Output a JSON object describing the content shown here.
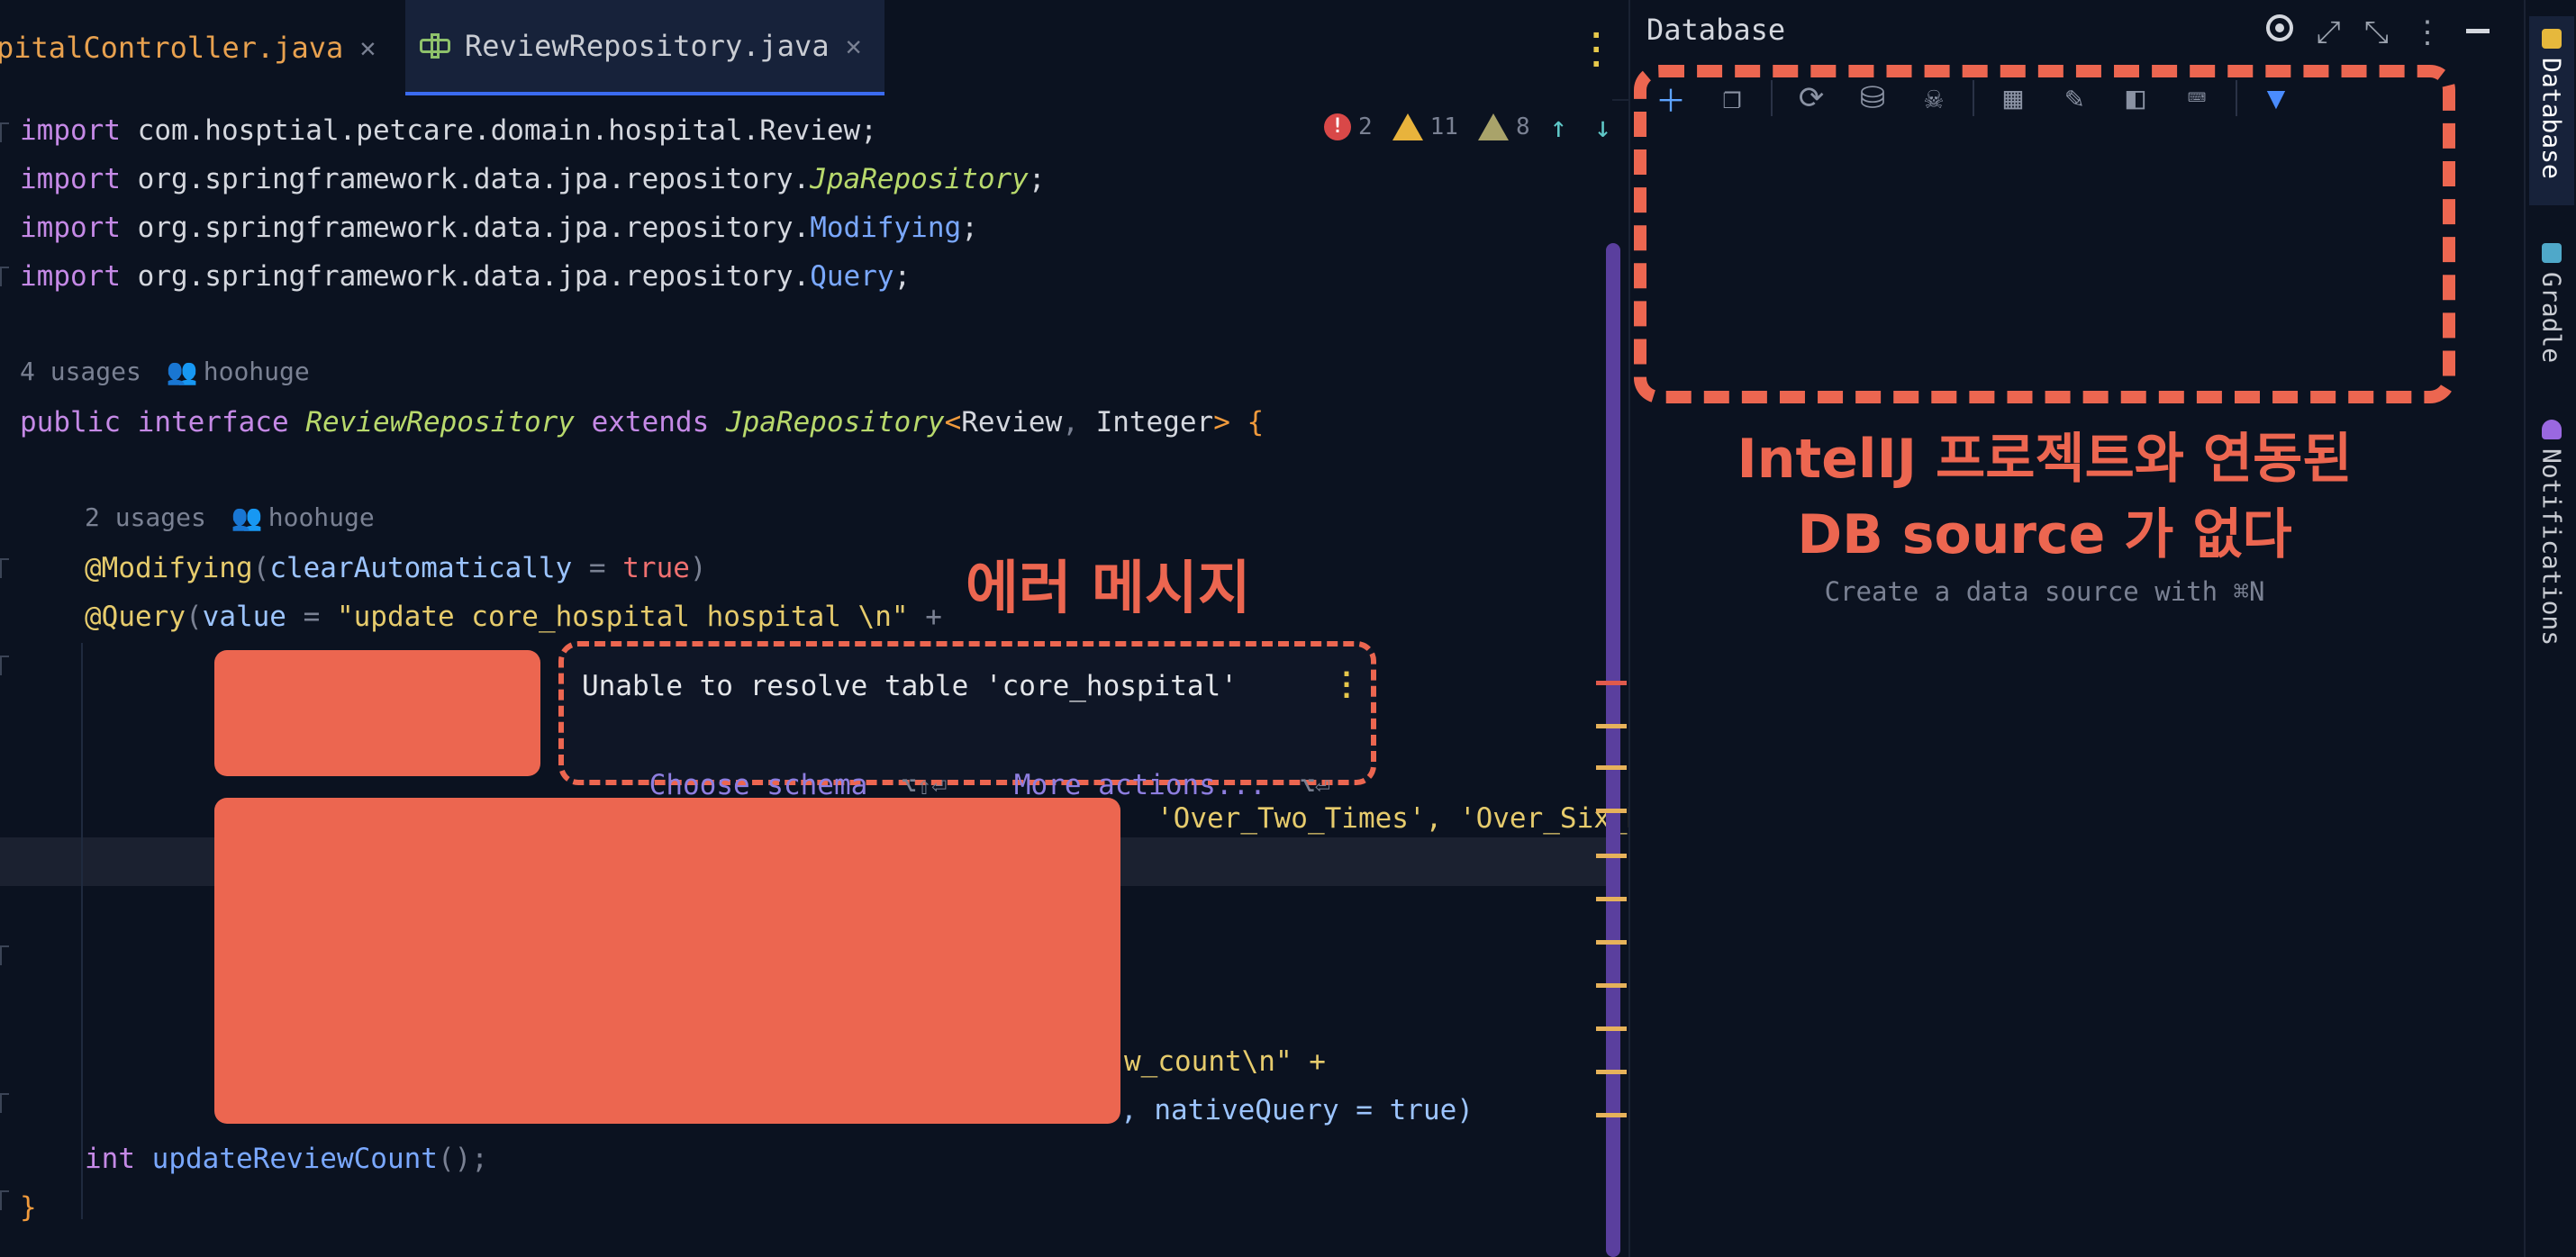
{
  "tabs": [
    {
      "label": "pitalController.java",
      "active": false
    },
    {
      "label": "ReviewRepository.java",
      "active": true
    }
  ],
  "inspections": {
    "errors": "2",
    "warnings": "11",
    "weak_warnings": "8"
  },
  "code": {
    "imports": [
      {
        "kw": "import",
        "pkg": "com.hosptial.petcare.domain.hospital.",
        "cls": "Review",
        "semi": ";"
      },
      {
        "kw": "import",
        "pkg": "org.springframework.data.jpa.repository.",
        "cls": "JpaRepository",
        "semi": ";"
      },
      {
        "kw": "import",
        "pkg": "org.springframework.data.jpa.repository.",
        "cls": "Modifying",
        "semi": ";"
      },
      {
        "kw": "import",
        "pkg": "org.springframework.data.jpa.repository.",
        "cls": "Query",
        "semi": ";"
      }
    ],
    "hint1": {
      "usages": "4 usages",
      "author": "hoohuge"
    },
    "interface_line": {
      "kw1": "public",
      "kw2": "interface",
      "name": "ReviewRepository",
      "kw3": "extends",
      "parent": "JpaRepository",
      "generic_open": "<",
      "t1": "Review",
      "comma": ", ",
      "t2": "Integer",
      "generic_close": ">",
      "brace": " {"
    },
    "hint2": {
      "usages": "2 usages",
      "author": "hoohuge"
    },
    "modifying": {
      "ann": "@Modifying",
      "open": "(",
      "param": "clearAutomatically",
      "eq": " = ",
      "value": "true",
      "close": ")"
    },
    "query": {
      "ann": "@Query",
      "open": "(",
      "param": "value",
      "eq": " = ",
      "str": "\"update core_hospital hospital \\n\"",
      "plus": " +"
    },
    "visible_fragment_1": "'Over_Two_Times', 'Over_Six_M",
    "visible_fragment_2": "w_count\\n\" +",
    "visible_fragment_3": ", nativeQuery = true)",
    "method": {
      "type": "int",
      "name": "updateReviewCount",
      "parens": "();"
    },
    "closing": "}"
  },
  "popup": {
    "message": "Unable to resolve table 'core_hospital'",
    "action1": "Choose schema",
    "key1": "⌥⇧⏎",
    "action2": "More actions...",
    "key2": "⌥⏎"
  },
  "annotation_error": "에러 메시지",
  "db_panel": {
    "title": "Database",
    "annotation_line1": "IntelIJ 프로젝트와 연동된",
    "annotation_line2": "DB source 가 없다",
    "empty_text": "Create a data source with ⌘N"
  },
  "side_strip": {
    "database": "Database",
    "gradle": "Gradle",
    "notifications": "Notifications"
  },
  "colors": {
    "accent_red": "#ec6650",
    "scrollbar": "#5a3f9e",
    "editor_bg": "#0b1220"
  }
}
